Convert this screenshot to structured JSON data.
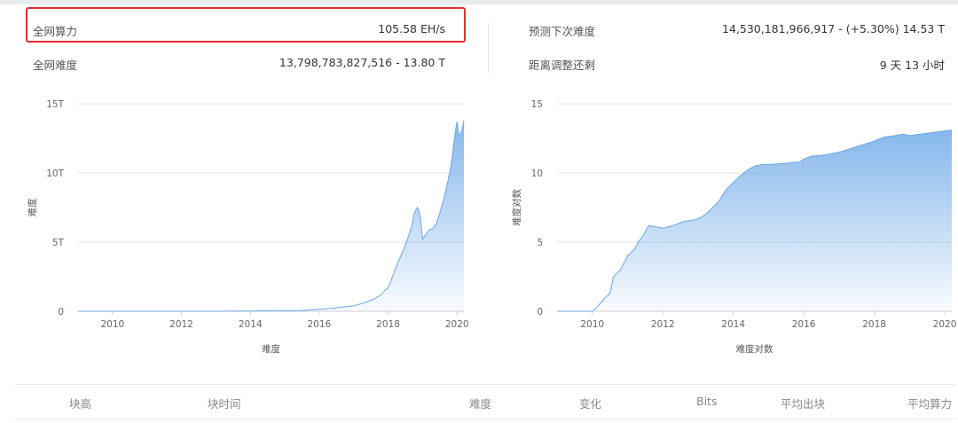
{
  "stats": {
    "hashrate_label": "全网算力",
    "hashrate_value": "105.58 EH/s",
    "difficulty_label": "全网难度",
    "difficulty_value": "13,798,783,827,516 - 13.80 T",
    "next_difficulty_label": "预测下次难度",
    "next_difficulty_value": "14,530,181,966,917 - (+5.30%) 14.53 T",
    "time_left_label": "距离调整还剩",
    "time_left_value": "9 天 13 小时"
  },
  "colors": {
    "accent": "#7fb3ea",
    "highlight": "#e0302a"
  },
  "chart_data": [
    {
      "type": "area",
      "title": "",
      "xlabel": "难度",
      "ylabel": "难度",
      "xlim": [
        2009.0,
        2020.2
      ],
      "ylim": [
        0,
        15
      ],
      "x_ticks": [
        "2010",
        "2012",
        "2014",
        "2016",
        "2018",
        "2020"
      ],
      "y_ticks": [
        "0",
        "5T",
        "10T",
        "15T"
      ],
      "grid": true,
      "series": [
        {
          "x": [
            2009.0,
            2011.0,
            2013.0,
            2014.0,
            2014.5,
            2015.0,
            2015.5,
            2016.0,
            2016.5,
            2017.0,
            2017.3,
            2017.6,
            2017.8,
            2017.9,
            2018.0,
            2018.1,
            2018.2,
            2018.3,
            2018.4,
            2018.5,
            2018.6,
            2018.7,
            2018.75,
            2018.8,
            2018.85,
            2018.9,
            2018.95,
            2019.0,
            2019.1,
            2019.2,
            2019.3,
            2019.4,
            2019.5,
            2019.6,
            2019.7,
            2019.8,
            2019.85,
            2019.9,
            2019.95,
            2020.0,
            2020.05,
            2020.1,
            2020.15,
            2020.2
          ],
          "values": [
            0,
            0,
            0.001,
            0.02,
            0.04,
            0.05,
            0.06,
            0.15,
            0.25,
            0.4,
            0.6,
            0.9,
            1.2,
            1.5,
            1.7,
            2.3,
            3.0,
            3.6,
            4.2,
            4.8,
            5.5,
            6.3,
            7.0,
            7.3,
            7.5,
            7.2,
            6.5,
            5.2,
            5.6,
            5.9,
            6.0,
            6.3,
            7.1,
            8.0,
            9.0,
            10.2,
            11.0,
            12.0,
            13.0,
            13.7,
            12.8,
            12.8,
            13.2,
            13.8
          ]
        }
      ]
    },
    {
      "type": "area",
      "title": "",
      "xlabel": "难度对数",
      "ylabel": "难度对数",
      "xlim": [
        2009.0,
        2020.2
      ],
      "ylim": [
        0,
        15
      ],
      "x_ticks": [
        "2010",
        "2012",
        "2014",
        "2016",
        "2018",
        "2020"
      ],
      "y_ticks": [
        "0",
        "5",
        "10",
        "15"
      ],
      "grid": true,
      "series": [
        {
          "x": [
            2009.0,
            2010.0,
            2010.1,
            2010.3,
            2010.5,
            2010.6,
            2010.8,
            2011.0,
            2011.2,
            2011.3,
            2011.45,
            2011.6,
            2011.8,
            2012.0,
            2012.3,
            2012.6,
            2012.9,
            2013.1,
            2013.3,
            2013.6,
            2013.8,
            2014.0,
            2014.2,
            2014.4,
            2014.6,
            2014.8,
            2015.0,
            2015.5,
            2015.9,
            2016.0,
            2016.2,
            2016.6,
            2017.0,
            2017.5,
            2018.0,
            2018.3,
            2018.6,
            2018.8,
            2019.0,
            2019.3,
            2019.6,
            2019.9,
            2020.2
          ],
          "values": [
            0,
            0,
            0.2,
            0.8,
            1.3,
            2.5,
            3.0,
            4.0,
            4.5,
            5.0,
            5.5,
            6.2,
            6.1,
            6.0,
            6.2,
            6.5,
            6.6,
            6.8,
            7.2,
            8.0,
            8.8,
            9.3,
            9.8,
            10.2,
            10.5,
            10.6,
            10.6,
            10.7,
            10.8,
            11.0,
            11.2,
            11.3,
            11.5,
            11.9,
            12.3,
            12.6,
            12.7,
            12.8,
            12.7,
            12.8,
            12.9,
            13.0,
            13.1
          ]
        }
      ]
    }
  ],
  "table": {
    "headers": [
      "块高",
      "块时间",
      "难度",
      "变化",
      "Bits",
      "平均出块",
      "平均算力"
    ]
  }
}
